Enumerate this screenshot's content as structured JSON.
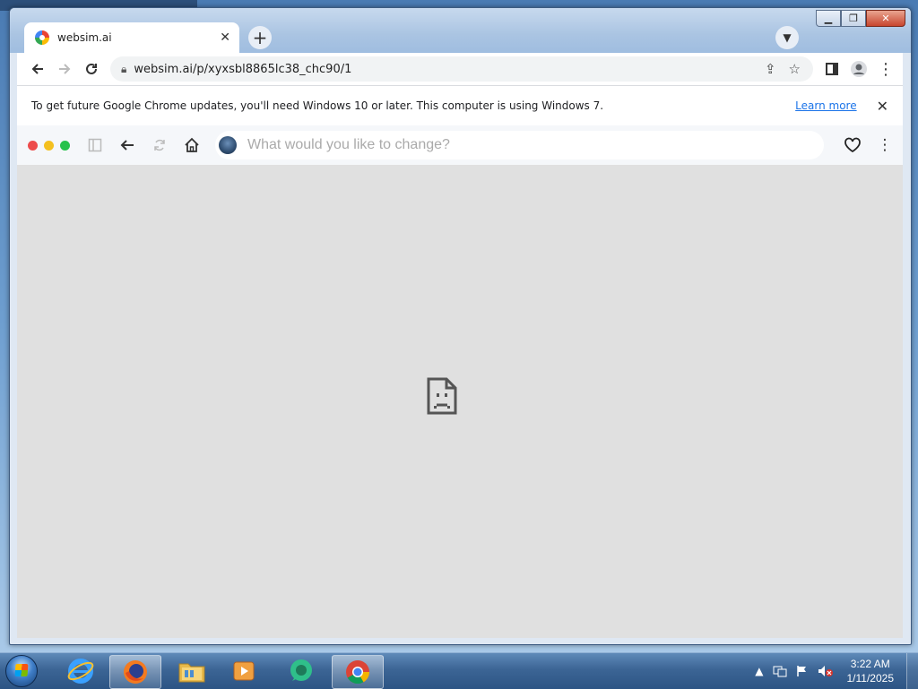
{
  "browser": {
    "tab_title": "websim.ai",
    "new_tab_symbol": "+",
    "close_tab_symbol": "✕",
    "url": "websim.ai/p/xyxsbl8865lc38_chc90/1"
  },
  "infobar": {
    "message": "To get future Google Chrome updates, you'll need Windows 10 or later. This computer is using Windows 7.",
    "link": "Learn more",
    "close_symbol": "✕"
  },
  "websim": {
    "placeholder": "What would you like to change?",
    "traffic_lights": [
      "#ed4c4c",
      "#f4c01f",
      "#27c24c"
    ]
  },
  "content": {
    "state": "page-error",
    "background": "#e0e0e0"
  },
  "taskbar": {
    "apps": [
      "internet-explorer-icon",
      "firefox-icon",
      "file-explorer-icon",
      "media-player-icon",
      "messenger-icon",
      "chrome-icon"
    ],
    "time": "3:22 AM",
    "date": "1/11/2025"
  }
}
